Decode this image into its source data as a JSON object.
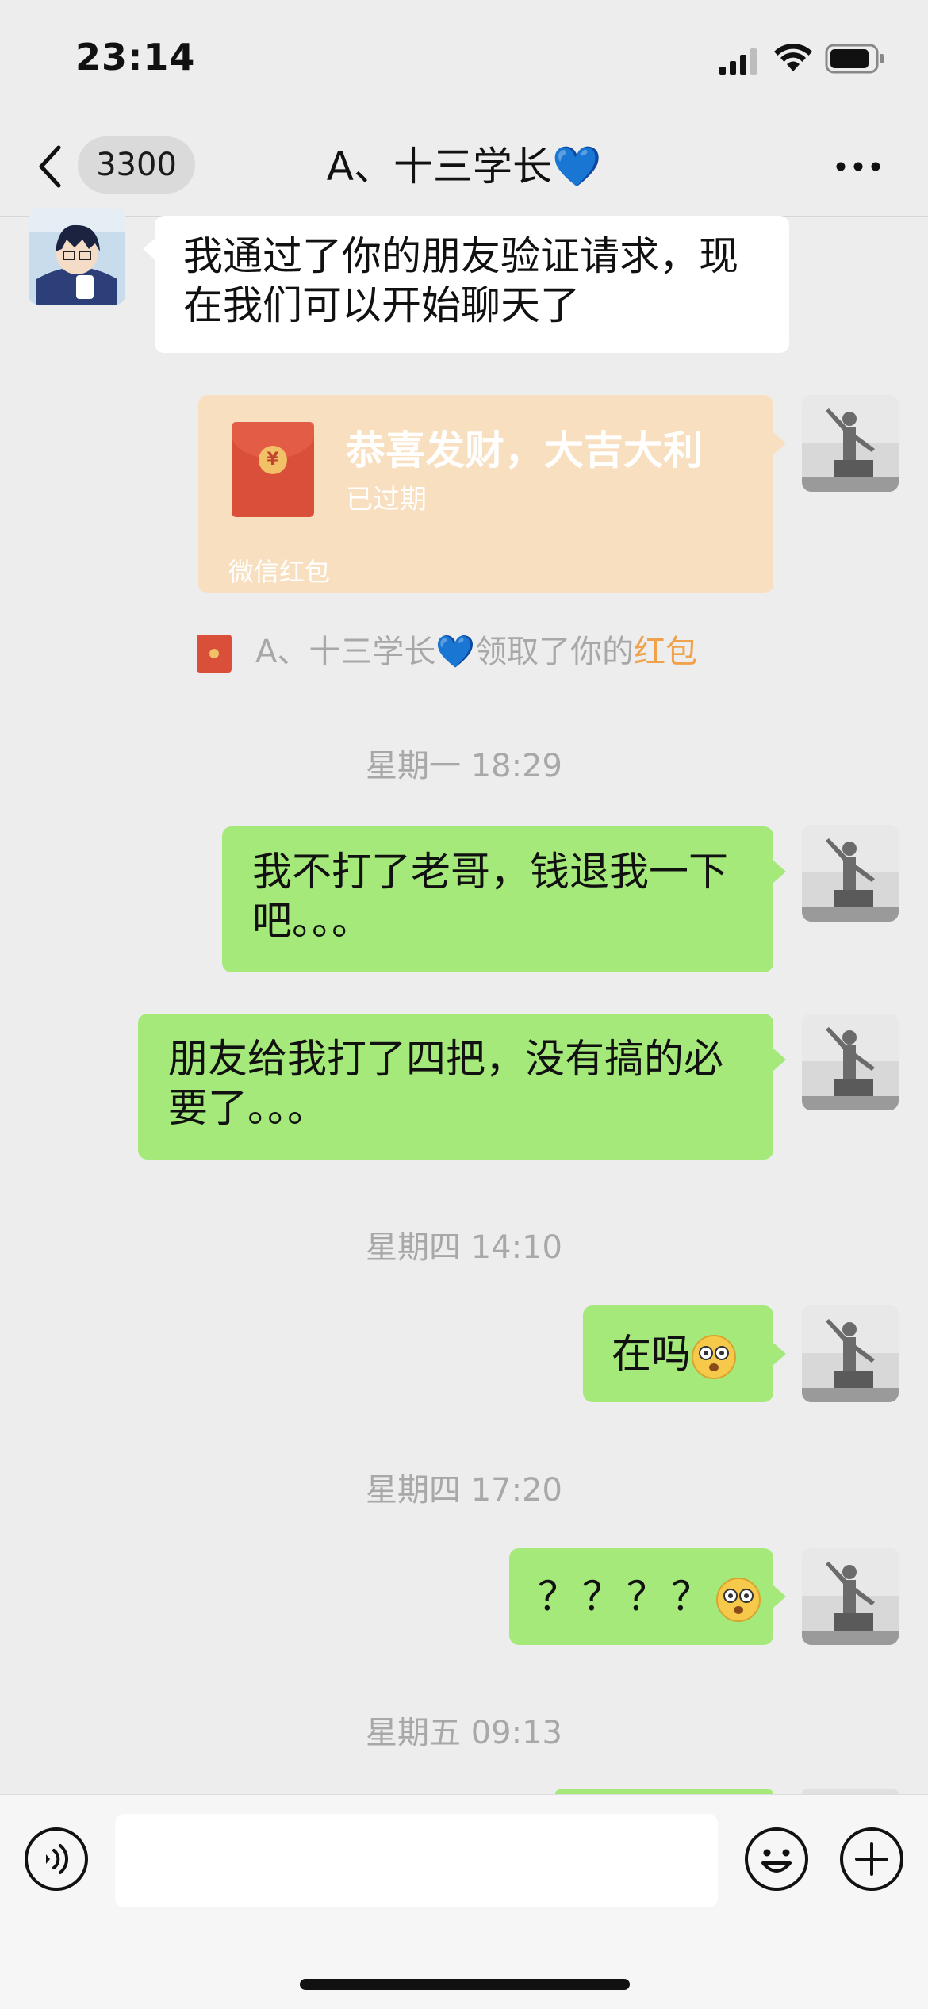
{
  "status_bar": {
    "time": "23:14"
  },
  "nav": {
    "unread_count": "3300",
    "title": "A、十三学长💙"
  },
  "messages": [
    {
      "side": "left",
      "text": "我通过了你的朋友验证请求，现在我们可以开始聊天了"
    },
    {
      "side": "right",
      "text": "我不打了老哥，钱退我一下吧。。。"
    },
    {
      "side": "right",
      "text": "朋友给我打了四把，没有搞的必要了。。。"
    },
    {
      "side": "right",
      "text": "在吗"
    },
    {
      "side": "right",
      "text": "？？？？"
    }
  ],
  "red_packet": {
    "title": "恭喜发财，大吉大利",
    "status": "已过期",
    "footer": "微信红包",
    "coin_symbol": "¥"
  },
  "system_message": {
    "prefix": "A、十三学长💙领取了你的",
    "highlight": "红包"
  },
  "timestamps": [
    "星期一 18:29",
    "星期四 14:10",
    "星期四 17:20",
    "星期五 09:13"
  ],
  "input": {
    "value": "",
    "placeholder": ""
  },
  "icons": {
    "back": "chevron-left-icon",
    "more": "more-dots-icon",
    "voice": "voice-icon",
    "emoji": "emoji-icon",
    "plus": "plus-icon",
    "signal": "signal-icon",
    "wifi": "wifi-icon",
    "battery": "battery-icon"
  },
  "colors": {
    "background": "#ededed",
    "bubble_green": "#a5e97a",
    "bubble_white": "#ffffff",
    "red_packet_expired": "#f8dfc0",
    "highlight_orange": "#f0a14a"
  }
}
